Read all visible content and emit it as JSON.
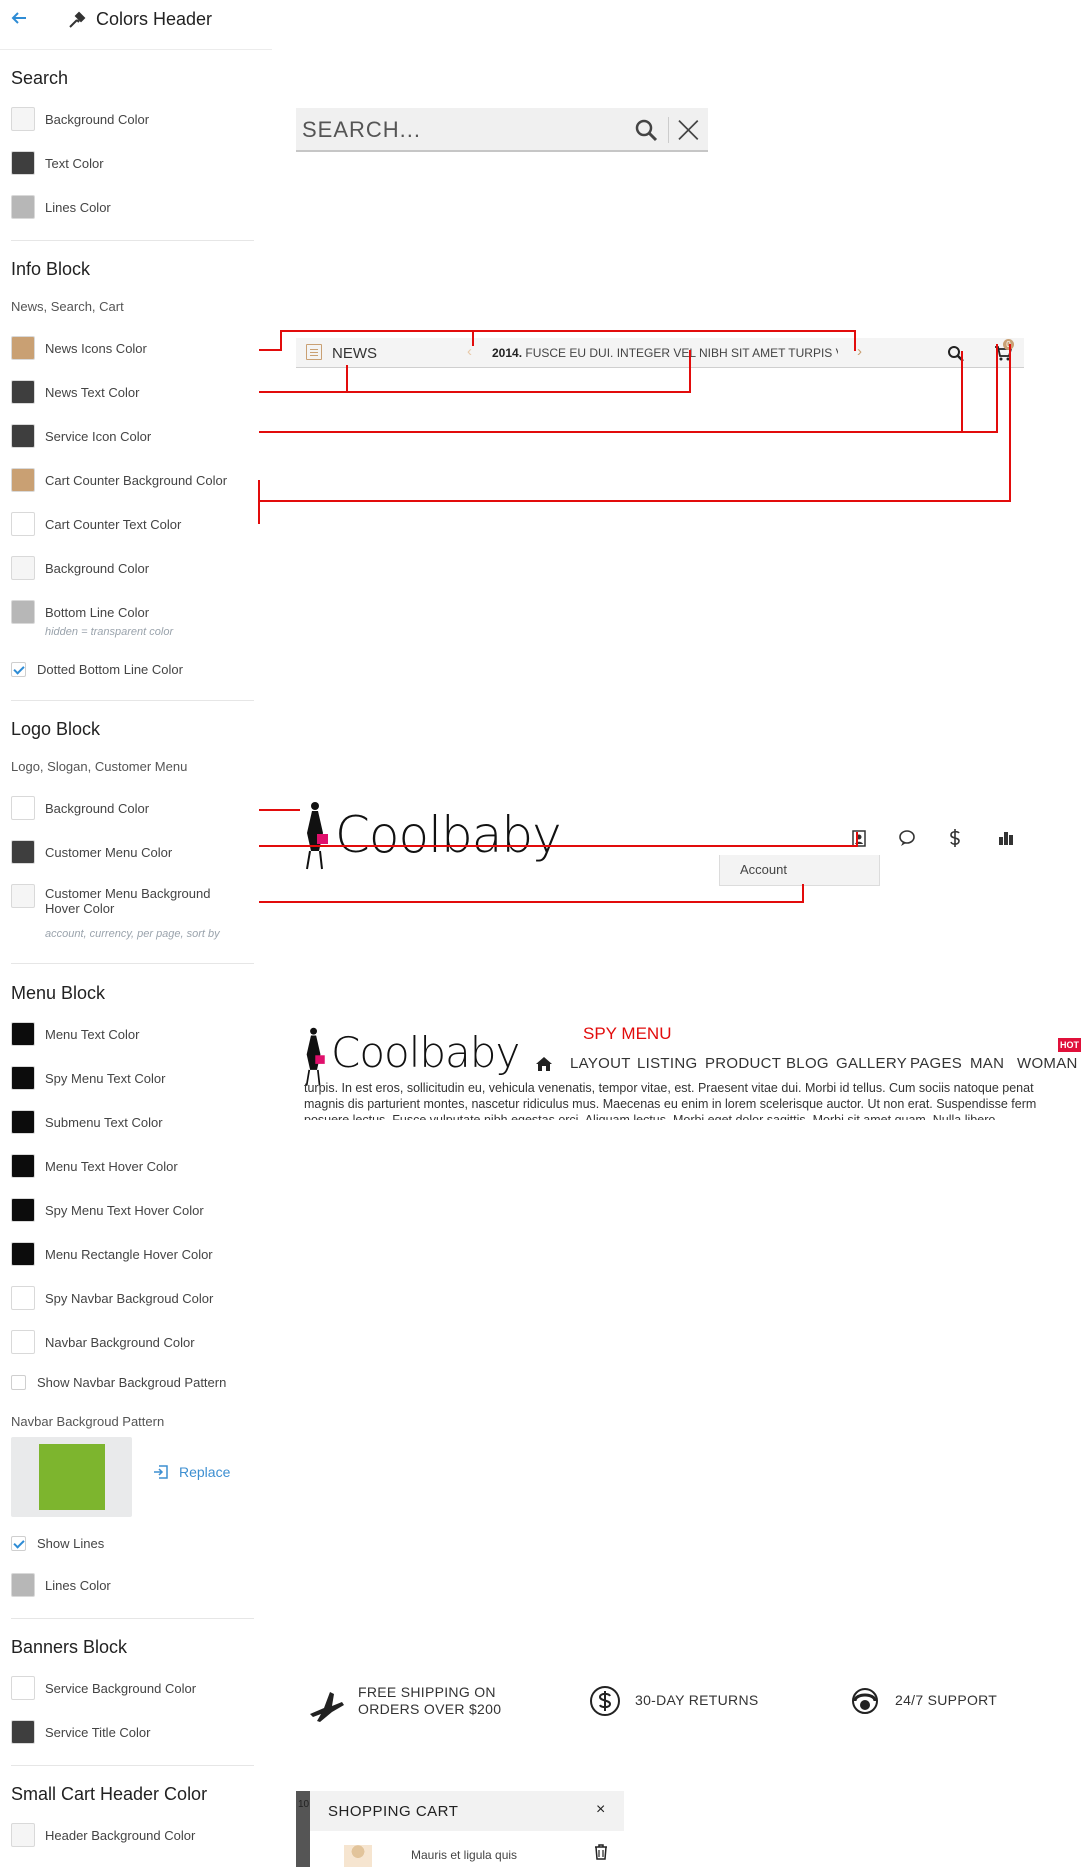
{
  "colors": {
    "accent_blue": "#2e8cd5",
    "annotation_red": "#e20c0c",
    "tan": "#c9a073",
    "dark": "#3e3e3e",
    "black": "#0c0c0c",
    "light": "#f5f5f5",
    "white": "#ffffff",
    "gray": "#b7b7b7",
    "pattern_green": "#7db52e",
    "hot_red": "#e0103a"
  },
  "header": {
    "back_icon": "arrow-left-icon",
    "title_icon": "eyedropper-icon",
    "title": "Colors Header"
  },
  "search_section": {
    "title": "Search",
    "items": [
      {
        "label": "Background Color",
        "color": "#f5f5f5"
      },
      {
        "label": "Text Color",
        "color": "#3e3e3e"
      },
      {
        "label": "Lines Color",
        "color": "#b7b7b7"
      }
    ]
  },
  "info_section": {
    "title": "Info Block",
    "subtitle": "News, Search, Cart",
    "items": [
      {
        "label": "News Icons Color",
        "color": "#c9a073"
      },
      {
        "label": "News Text Color",
        "color": "#3e3e3e"
      },
      {
        "label": "Service Icon Color",
        "color": "#3e3e3e"
      },
      {
        "label": "Cart Counter Background Color",
        "color": "#c9a073"
      },
      {
        "label": "Cart Counter Text Color",
        "color": "#ffffff"
      },
      {
        "label": "Background Color",
        "color": "#f5f5f5"
      },
      {
        "label": "Bottom Line Color",
        "color": "#b7b7b7"
      }
    ],
    "bottom_line_hint": "hidden = transparent color",
    "dotted_checkbox": {
      "label": "Dotted Bottom Line Color",
      "checked": true
    }
  },
  "logo_section": {
    "title": "Logo Block",
    "subtitle": "Logo, Slogan, Customer Menu",
    "items": [
      {
        "label": "Background Color",
        "color": "#ffffff"
      },
      {
        "label": "Customer Menu Color",
        "color": "#3e3e3e"
      }
    ],
    "hover_item": {
      "label_line1": "Customer Menu Background",
      "label_line2": "Hover Color",
      "color": "#f5f5f5"
    },
    "hover_hint": "account, currency, per page, sort by"
  },
  "menu_section": {
    "title": "Menu Block",
    "items": [
      {
        "label": "Menu Text Color",
        "color": "#0c0c0c"
      },
      {
        "label": "Spy Menu Text Color",
        "color": "#0c0c0c"
      },
      {
        "label": "Submenu Text Color",
        "color": "#0c0c0c"
      },
      {
        "label": "Menu Text Hover Color",
        "color": "#0c0c0c"
      },
      {
        "label": "Spy Menu Text Hover Color",
        "color": "#0c0c0c"
      },
      {
        "label": "Menu Rectangle Hover Color",
        "color": "#0c0c0c"
      },
      {
        "label": "Spy Navbar Backgroud Color",
        "color": "#ffffff"
      },
      {
        "label": "Navbar Background Color",
        "color": "#ffffff"
      }
    ],
    "pattern_checkbox": {
      "label": "Show Navbar Backgroud Pattern",
      "checked": false
    },
    "pattern_title": "Navbar Backgroud Pattern",
    "replace_label": "Replace",
    "lines_checkbox": {
      "label": "Show Lines",
      "checked": true
    },
    "lines_color": {
      "label": "Lines Color",
      "color": "#b7b7b7"
    }
  },
  "banners_section": {
    "title": "Banners Block",
    "items": [
      {
        "label": "Service Background Color",
        "color": "#ffffff"
      },
      {
        "label": "Service Title Color",
        "color": "#3e3e3e"
      }
    ]
  },
  "small_cart_section": {
    "title": "Small Cart Header Color",
    "items": [
      {
        "label": "Header Background Color",
        "color": "#f5f5f5"
      }
    ]
  },
  "preview": {
    "search_placeholder": "SEARCH...",
    "news_label": "NEWS",
    "news_ticker_bold": "2014.",
    "news_ticker_text": " FUSCE EU DUI. INTEGER VEL NIBH SIT AMET TURPIS VULI",
    "cart_count": "0",
    "logo_text": "Coolbaby",
    "account_label": "Account",
    "spy_menu_label": "SPY MENU",
    "nav_items": [
      "LAYOUT",
      "LISTING",
      "PRODUCT",
      "BLOG",
      "GALLERY",
      "PAGES",
      "MAN",
      "WOMAN"
    ],
    "hot_badge": "HOT",
    "lorem_lines": [
      "turpis. In est eros, sollicitudin eu, vehicula venenatis, tempor vitae, est. Praesent vitae dui. Morbi id tellus. Cum sociis natoque penat",
      "magnis dis parturient montes, nascetur ridiculus mus. Maecenas eu enim in lorem scelerisque auctor. Ut non erat. Suspendisse ferm",
      "posuere lectus. Fusce vulputate nibh egestas orci. Aliquam lectus. Morbi eget dolor sagittis. Morbi sit amet quam. Nulla libero"
    ],
    "services": [
      {
        "icon": "airplane-icon",
        "line1": "FREE SHIPPING ON",
        "line2": "ORDERS OVER $200"
      },
      {
        "icon": "dollar-circle-icon",
        "line1": "30-DAY RETURNS",
        "line2": ""
      },
      {
        "icon": "support-headset-icon",
        "line1": "24/7 SUPPORT",
        "line2": ""
      }
    ],
    "cart_panel_strip": "10",
    "cart_panel_title": "SHOPPING CART",
    "cart_panel_close": "×",
    "cart_item_name": "Mauris et ligula quis"
  }
}
